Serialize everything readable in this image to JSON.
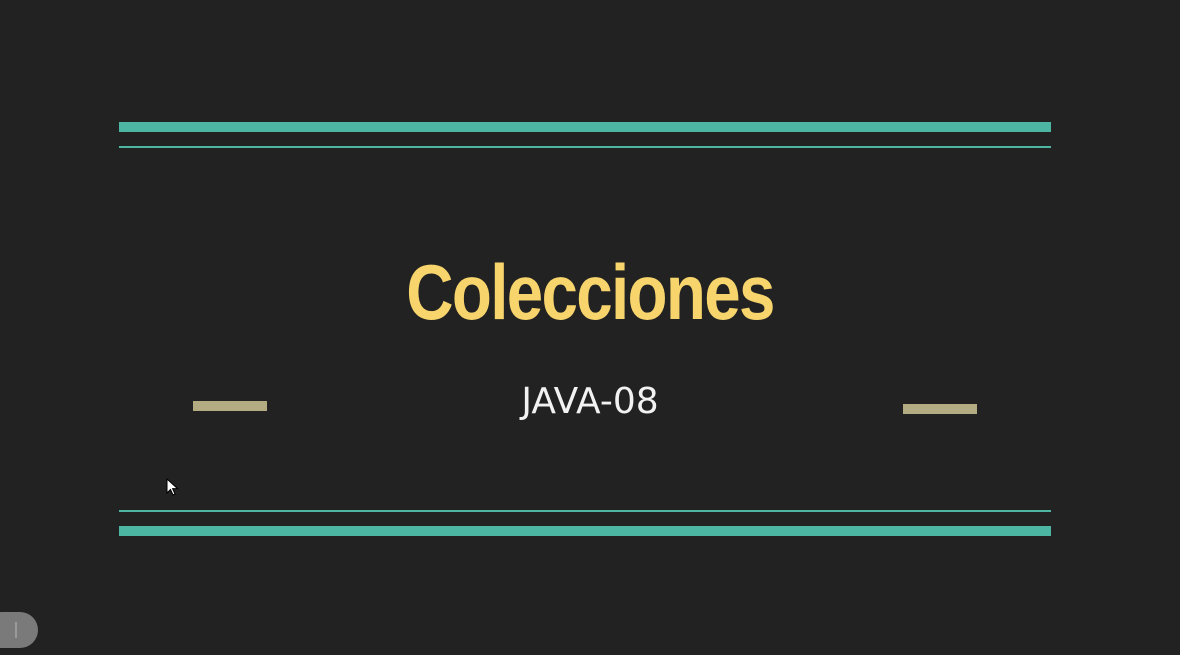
{
  "slide": {
    "title": "Colecciones",
    "subtitle": "JAVA-08"
  },
  "colors": {
    "background": "#222222",
    "accent_teal": "#4db6a2",
    "title_yellow": "#f7d56c",
    "subtitle_white": "#f2f2f2",
    "bar_tan": "#b3ab82"
  },
  "icons": {
    "cursor": "mouse-pointer-icon",
    "corner_control": "player-control-pill"
  }
}
